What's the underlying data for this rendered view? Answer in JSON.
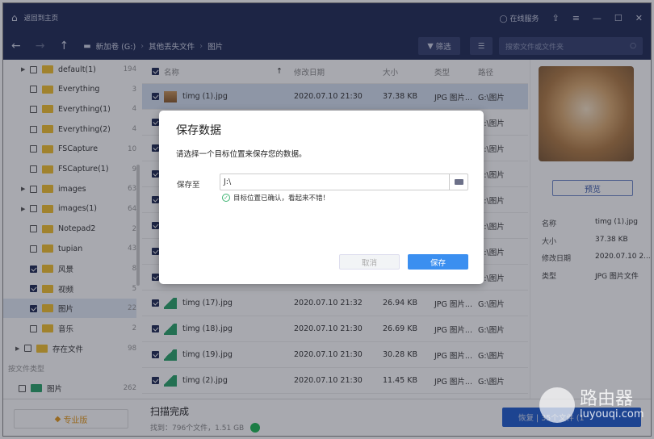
{
  "titlebar": {
    "home_label": "返回到主页",
    "service": "在线服务"
  },
  "toolbar": {
    "crumbs": [
      "新加卷 (G:)",
      "其他丢失文件",
      "图片"
    ],
    "filter": "筛选",
    "search_placeholder": "搜索文件或文件夹"
  },
  "sidebar": {
    "items": [
      {
        "label": "default(1)",
        "count": "194",
        "expand": true,
        "checked": false
      },
      {
        "label": "Everything",
        "count": "3",
        "expand": false,
        "checked": false
      },
      {
        "label": "Everything(1)",
        "count": "4",
        "expand": false,
        "checked": false
      },
      {
        "label": "Everything(2)",
        "count": "4",
        "expand": false,
        "checked": false
      },
      {
        "label": "FSCapture",
        "count": "10",
        "expand": false,
        "checked": false
      },
      {
        "label": "FSCapture(1)",
        "count": "9",
        "expand": false,
        "checked": false
      },
      {
        "label": "images",
        "count": "63",
        "expand": true,
        "checked": false
      },
      {
        "label": "images(1)",
        "count": "64",
        "expand": true,
        "checked": false
      },
      {
        "label": "Notepad2",
        "count": "2",
        "expand": false,
        "checked": false
      },
      {
        "label": "tupian",
        "count": "43",
        "expand": false,
        "checked": false
      },
      {
        "label": "风景",
        "count": "8",
        "expand": false,
        "checked": true
      },
      {
        "label": "视频",
        "count": "5",
        "expand": false,
        "checked": true
      },
      {
        "label": "图片",
        "count": "22",
        "expand": false,
        "checked": true,
        "selected": true
      },
      {
        "label": "音乐",
        "count": "2",
        "expand": false,
        "checked": false
      }
    ],
    "root": {
      "label": "存在文件",
      "count": "98"
    },
    "section": "按文件类型",
    "type_item": {
      "label": "图片",
      "count": "262"
    },
    "pro": "专业版"
  },
  "list": {
    "headers": [
      "名称",
      "修改日期",
      "大小",
      "类型",
      "路径"
    ],
    "rows": [
      {
        "name": "timg (1).jpg",
        "date": "2020.07.10 21:30",
        "size": "37.38 KB",
        "type": "JPG 图片...",
        "path": "G:\\图片",
        "photo": true
      },
      {
        "name": "",
        "date": "",
        "size": "",
        "type": "",
        "path": "G:\\图片"
      },
      {
        "name": "",
        "date": "",
        "size": "",
        "type": "",
        "path": "G:\\图片"
      },
      {
        "name": "",
        "date": "",
        "size": "",
        "type": "",
        "path": "G:\\图片"
      },
      {
        "name": "",
        "date": "",
        "size": "",
        "type": "",
        "path": "G:\\图片"
      },
      {
        "name": "",
        "date": "",
        "size": "",
        "type": "",
        "path": "G:\\图片"
      },
      {
        "name": "",
        "date": "",
        "size": "",
        "type": "",
        "path": "G:\\图片"
      },
      {
        "name": "",
        "date": "",
        "size": "",
        "type": "",
        "path": "G:\\图片"
      },
      {
        "name": "timg (17).jpg",
        "date": "2020.07.10 21:32",
        "size": "26.94 KB",
        "type": "JPG 图片...",
        "path": "G:\\图片"
      },
      {
        "name": "timg (18).jpg",
        "date": "2020.07.10 21:30",
        "size": "26.69 KB",
        "type": "JPG 图片...",
        "path": "G:\\图片"
      },
      {
        "name": "timg (19).jpg",
        "date": "2020.07.10 21:30",
        "size": "30.28 KB",
        "type": "JPG 图片...",
        "path": "G:\\图片"
      },
      {
        "name": "timg (2).jpg",
        "date": "2020.07.10 21:30",
        "size": "11.45 KB",
        "type": "JPG 图片...",
        "path": "G:\\图片"
      }
    ]
  },
  "preview": {
    "button": "预览",
    "info": [
      [
        "名称",
        "timg (1).jpg"
      ],
      [
        "大小",
        "37.38 KB"
      ],
      [
        "修改日期",
        "2020.07.10 2..."
      ],
      [
        "类型",
        "JPG 图片文件"
      ]
    ]
  },
  "status": {
    "title": "扫描完成",
    "found": "找到：796个文件，1.51 GB",
    "restore": "恢复 | 35个文件 (1"
  },
  "dialog": {
    "title": "保存数据",
    "desc": "请选择一个目标位置来保存您的数据。",
    "label": "保存至",
    "value": "J:\\",
    "valid": "目标位置已确认，看起来不错！",
    "cancel": "取消",
    "save": "保存"
  },
  "watermark": {
    "cn": "路由器",
    "url": "luyouqi.com"
  }
}
